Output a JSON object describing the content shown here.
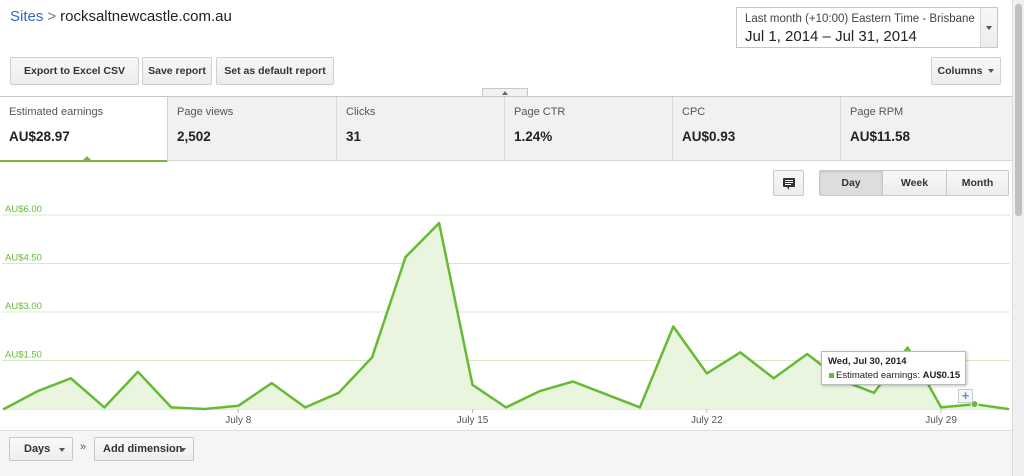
{
  "breadcrumb": {
    "root": "Sites",
    "separator": ">",
    "current": "rocksaltnewcastle.com.au"
  },
  "date_range": {
    "preset": "Last month (+10:00) Eastern Time - Brisbane",
    "range": "Jul 1, 2014 – Jul 31, 2014"
  },
  "toolbar": {
    "export": "Export to Excel CSV",
    "save": "Save report",
    "set_default": "Set as default report",
    "columns": "Columns"
  },
  "metrics": [
    {
      "label": "Estimated earnings",
      "value": "AU$28.97",
      "active": true
    },
    {
      "label": "Page views",
      "value": "2,502"
    },
    {
      "label": "Clicks",
      "value": "31"
    },
    {
      "label": "Page CTR",
      "value": "1.24%"
    },
    {
      "label": "CPC",
      "value": "AU$0.93"
    },
    {
      "label": "Page RPM",
      "value": "AU$11.58"
    }
  ],
  "granularity": {
    "day": "Day",
    "week": "Week",
    "month": "Month",
    "selected": "Day"
  },
  "chart_data": {
    "type": "area",
    "x": [
      "Jul 1",
      "Jul 2",
      "Jul 3",
      "Jul 4",
      "Jul 5",
      "Jul 6",
      "Jul 7",
      "Jul 8",
      "Jul 9",
      "Jul 10",
      "Jul 11",
      "Jul 12",
      "Jul 13",
      "Jul 14",
      "Jul 15",
      "Jul 16",
      "Jul 17",
      "Jul 18",
      "Jul 19",
      "Jul 20",
      "Jul 21",
      "Jul 22",
      "Jul 23",
      "Jul 24",
      "Jul 25",
      "Jul 26",
      "Jul 27",
      "Jul 28",
      "Jul 29",
      "Jul 30",
      "Jul 31"
    ],
    "series": [
      {
        "name": "Estimated earnings",
        "values": [
          0.0,
          0.55,
          0.95,
          0.05,
          1.15,
          0.05,
          0.0,
          0.1,
          0.8,
          0.05,
          0.5,
          1.6,
          4.7,
          5.75,
          0.75,
          0.05,
          0.55,
          0.85,
          0.45,
          0.05,
          2.55,
          1.1,
          1.75,
          0.95,
          1.7,
          0.9,
          0.5,
          1.9,
          0.05,
          0.15,
          0.0
        ],
        "color": "#66bb33"
      }
    ],
    "y_ticks": [
      "AU$1.50",
      "AU$3.00",
      "AU$4.50",
      "AU$6.00"
    ],
    "y_tick_values": [
      1.5,
      3.0,
      4.5,
      6.0
    ],
    "x_tick_labels": [
      "July 8",
      "July 15",
      "July 22",
      "July 29"
    ],
    "x_tick_indices": [
      7,
      14,
      21,
      28
    ],
    "ylim": [
      0,
      6.0
    ],
    "grid": true
  },
  "tooltip": {
    "title": "Wed, Jul 30, 2014",
    "label": "Estimated earnings:",
    "value": "AU$0.15"
  },
  "bottom": {
    "days": "Days",
    "chevrons": "»",
    "add_dimension": "Add dimension"
  },
  "colors": {
    "accent": "#66bb33",
    "fill": "#eaf5df",
    "grid": "#d6ebc5",
    "link": "#3366cc"
  }
}
